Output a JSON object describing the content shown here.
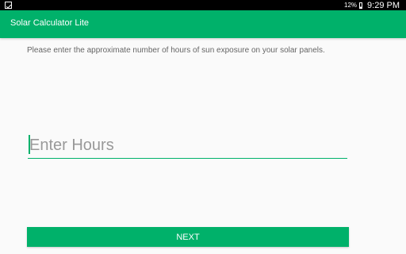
{
  "status_bar": {
    "battery": "12%",
    "time": "9:29 PM"
  },
  "app_bar": {
    "title": "Solar Calculator Lite"
  },
  "main": {
    "instructions": "Please enter the approximate number of hours of sun exposure on your solar panels.",
    "hours_input": {
      "value": "",
      "placeholder": "Enter Hours"
    },
    "next_label": "NEXT"
  },
  "colors": {
    "accent": "#00b16a",
    "status_bar": "#000000",
    "background": "#fafafa"
  },
  "icons": [
    "notification-icon",
    "battery-icon"
  ]
}
